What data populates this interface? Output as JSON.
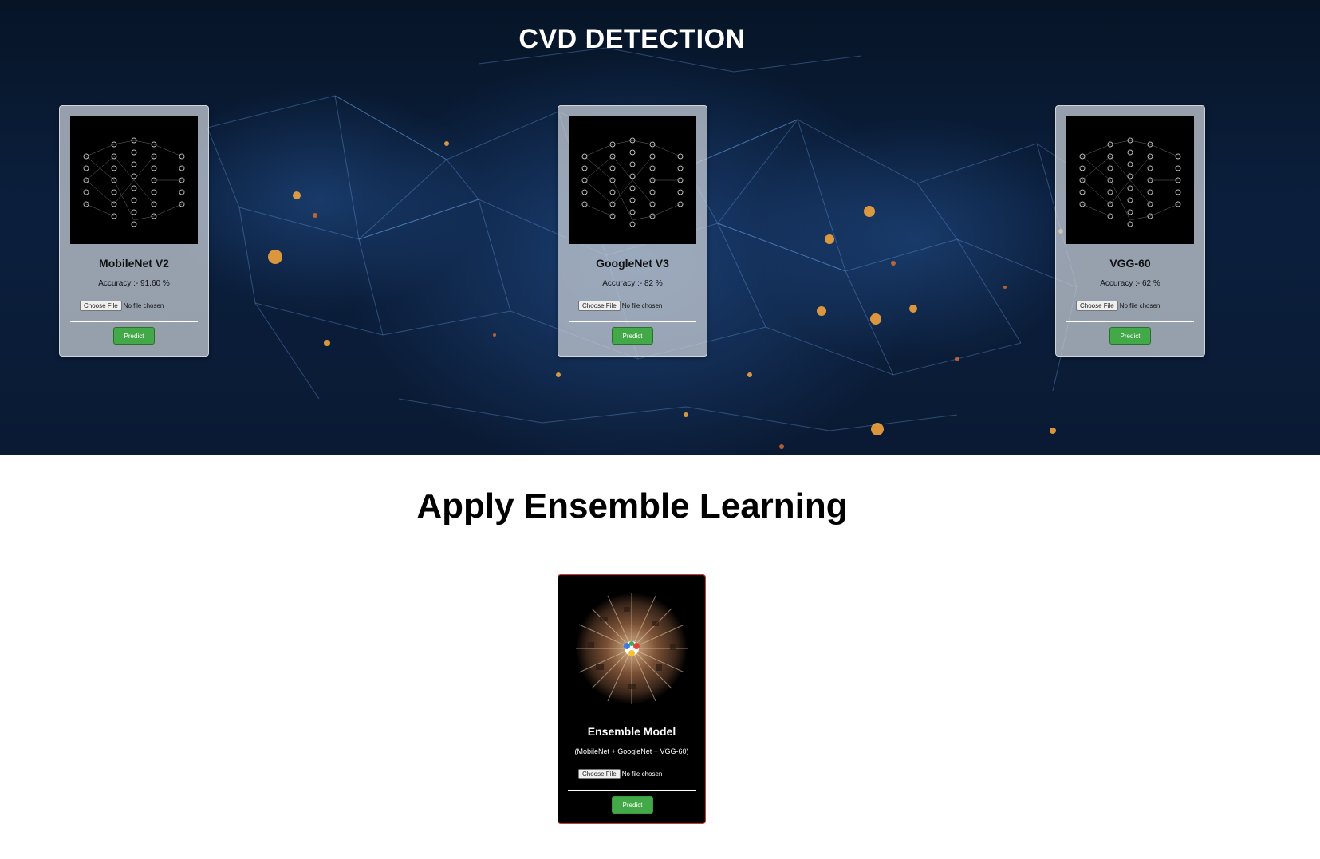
{
  "hero": {
    "title": "CVD DETECTION"
  },
  "models": [
    {
      "name": "MobileNet V2",
      "accuracy": "Accuracy :- 91.60 %",
      "file_button": "Choose File",
      "file_status": "No file chosen",
      "predict_label": "Predict"
    },
    {
      "name": "GoogleNet V3",
      "accuracy": "Accuracy :- 82 %",
      "file_button": "Choose File",
      "file_status": "No file chosen",
      "predict_label": "Predict"
    },
    {
      "name": "VGG-60",
      "accuracy": "Accuracy :- 62 %",
      "file_button": "Choose File",
      "file_status": "No file chosen",
      "predict_label": "Predict"
    }
  ],
  "ensemble_section": {
    "title": "Apply Ensemble Learning",
    "card": {
      "name": "Ensemble Model",
      "description": "(MobileNet + GoogleNet + VGG-60)",
      "file_button": "Choose File",
      "file_status": "No file chosen",
      "predict_label": "Predict"
    }
  },
  "colors": {
    "predict_button": "#43a847",
    "ensemble_border": "#d9342b",
    "hero_background": "#0b1f3d"
  },
  "icons": {
    "model_image": "neural-network-icon",
    "ensemble_image": "ensemble-sphere-icon"
  }
}
